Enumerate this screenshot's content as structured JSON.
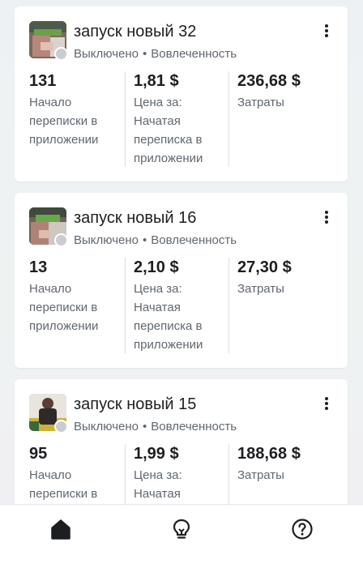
{
  "campaigns": [
    {
      "name": "запуск новый 32",
      "status": "Выключено",
      "objective": "Вовлеченность",
      "metrics": [
        {
          "value": "131",
          "label": "Начало\nпереписки в\nприложении"
        },
        {
          "value": "1,81 $",
          "label": "Цена за:\nНачатая\nпереписка в\nприложении"
        },
        {
          "value": "236,68 $",
          "label": "Затраты"
        }
      ]
    },
    {
      "name": "запуск новый 16",
      "status": "Выключено",
      "objective": "Вовлеченность",
      "metrics": [
        {
          "value": "13",
          "label": "Начало\nпереписки в\nприложении"
        },
        {
          "value": "2,10 $",
          "label": "Цена за:\nНачатая\nпереписка в\nприложении"
        },
        {
          "value": "27,30 $",
          "label": "Затраты"
        }
      ]
    },
    {
      "name": "запуск новый 15",
      "status": "Выключено",
      "objective": "Вовлеченность",
      "metrics": [
        {
          "value": "95",
          "label": "Начало\nпереписки в\nприложении"
        },
        {
          "value": "1,99 $",
          "label": "Цена за:\nНачатая\nпереписка в\nприложении"
        },
        {
          "value": "188,68 $",
          "label": "Затраты"
        }
      ]
    }
  ],
  "status_separator": "•",
  "tabbar": {
    "items": [
      {
        "icon": "home-icon",
        "active": true
      },
      {
        "icon": "lightbulb-icon",
        "active": false
      },
      {
        "icon": "help-icon",
        "active": false
      }
    ]
  },
  "colors": {
    "text_primary": "#1c1e21",
    "text_secondary": "#606770",
    "status_off": "#c9ccd1"
  }
}
